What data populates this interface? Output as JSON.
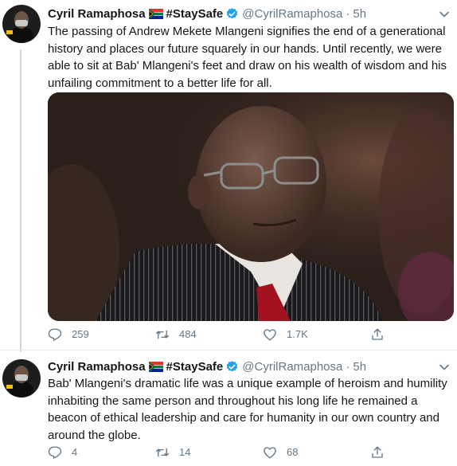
{
  "tweets": [
    {
      "display_name": "Cyril Ramaphosa",
      "hashtag": "#StaySafe",
      "handle": "@CyrilRamaphosa",
      "separator": "·",
      "time": "5h",
      "text": "The passing of Andrew Mekete Mlangeni signifies the end of a generational history and places our future squarely in our hands. Until recently, we were able to sit at Bab' Mlangeni's feet and draw on his wealth of wisdom and his unfailing commitment to a better life for all.",
      "replies": "259",
      "retweets": "484",
      "likes": "1.7K"
    },
    {
      "display_name": "Cyril Ramaphosa",
      "hashtag": "#StaySafe",
      "handle": "@CyrilRamaphosa",
      "separator": "·",
      "time": "5h",
      "text": "Bab' Mlangeni's dramatic life was a unique example of heroism and humility inhabiting the same person and throughout his long life he remained a beacon of ethical leadership and care for humanity in our own country and around the globe.",
      "replies": "4",
      "retweets": "14",
      "likes": "68"
    }
  ],
  "colors": {
    "text": "#14171a",
    "secondary": "#657786",
    "verified": "#1da1f2",
    "divider": "#e6ecf0"
  },
  "icons": [
    "south-africa-flag-icon",
    "verified-badge-icon",
    "chevron-down-icon",
    "reply-icon",
    "retweet-icon",
    "like-icon",
    "share-icon"
  ]
}
